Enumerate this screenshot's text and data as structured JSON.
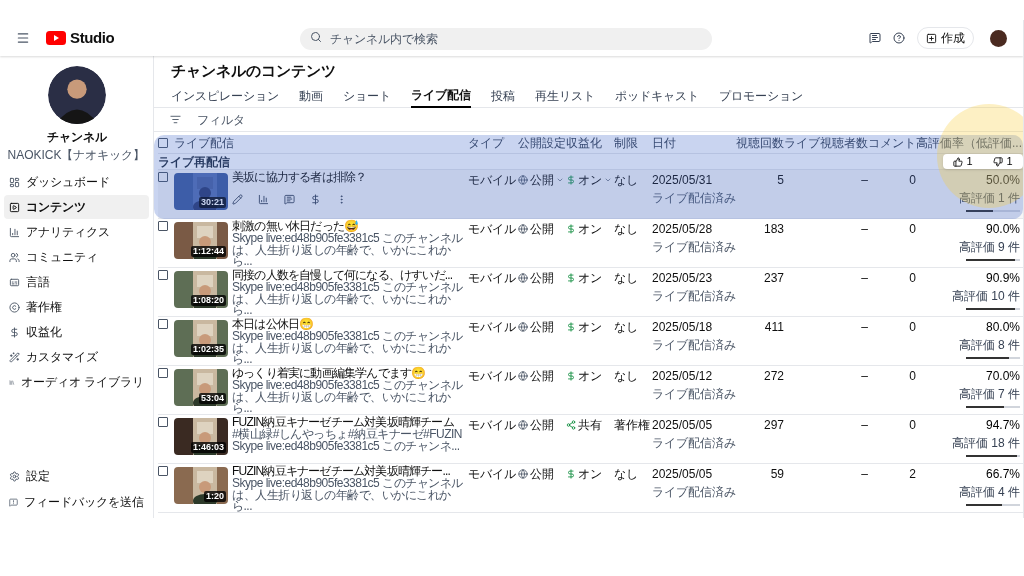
{
  "header": {
    "logo": "Studio",
    "search": {
      "placeholder": "チャンネル内で検索"
    },
    "create": "作成"
  },
  "sidebar": {
    "title": "チャンネル",
    "subtitle": "NAOKICK【ナオキック】",
    "items": [
      {
        "kind": "dashboard",
        "label": "ダッシュボード",
        "selected": false
      },
      {
        "kind": "content",
        "label": "コンテンツ",
        "selected": true
      },
      {
        "kind": "analytics",
        "label": "アナリティクス",
        "selected": false
      },
      {
        "kind": "community",
        "label": "コミュニティ",
        "selected": false
      },
      {
        "kind": "subtitles",
        "label": "言語",
        "selected": false
      },
      {
        "kind": "copyright",
        "label": "著作権",
        "selected": false
      },
      {
        "kind": "earn",
        "label": "収益化",
        "selected": false
      },
      {
        "kind": "customize",
        "label": "カスタマイズ",
        "selected": false
      },
      {
        "kind": "audio",
        "label": "オーディオ ライブラリ",
        "selected": false
      }
    ],
    "footer": [
      {
        "kind": "settings",
        "label": "設定"
      },
      {
        "kind": "feedback",
        "label": "フィードバックを送信"
      }
    ]
  },
  "page_title": "チャンネルのコンテンツ",
  "tabs": [
    {
      "label": "インスピレーション",
      "selected": false
    },
    {
      "label": "動画",
      "selected": false
    },
    {
      "label": "ショート",
      "selected": false
    },
    {
      "label": "ライブ配信",
      "selected": true
    },
    {
      "label": "投稿",
      "selected": false
    },
    {
      "label": "再生リスト",
      "selected": false
    },
    {
      "label": "ポッドキャスト",
      "selected": false
    },
    {
      "label": "プロモーション",
      "selected": false
    }
  ],
  "filter": {
    "placeholder": "フィルタ"
  },
  "table": {
    "select_all_checked": false,
    "columns": [
      "ライブ配信",
      "タイプ",
      "公開設定",
      "収益化",
      "制限",
      "日付",
      "視聴回数",
      "ライブ視聴者数",
      "コメント",
      "高評価率（低評価..."
    ],
    "group": "ライブ再配信",
    "rows": [
      {
        "checked": false,
        "title": "美坂に協力する者は排除？",
        "description": "",
        "duration": "30:21",
        "hovered": true,
        "type": "モバイル",
        "visibility": "公開",
        "monetization": {
          "kind": "dollar",
          "label": "オン"
        },
        "restriction": "なし",
        "date": "2025/05/31",
        "date_status": "ライブ配信済み",
        "views": "5",
        "live_viewers": "–",
        "comments": "0",
        "rating": "50.0%",
        "likes": "高評価 1 件",
        "level": 0.5,
        "tooltip": {
          "likes": "1",
          "dislikes": "1"
        }
      },
      {
        "checked": false,
        "title": "刺激の無い休日だった😅",
        "description": "Skype live:ed48b905fe3381c5 このチャンネルは、人生折り返しの年齢で、いかにこれから...",
        "duration": "1:12:44",
        "hovered": false,
        "type": "モバイル",
        "visibility": "公開",
        "monetization": {
          "kind": "dollar",
          "label": "オン"
        },
        "restriction": "なし",
        "date": "2025/05/28",
        "date_status": "ライブ配信済み",
        "views": "183",
        "live_viewers": "–",
        "comments": "0",
        "rating": "90.0%",
        "likes": "高評価 9 件",
        "level": 0.9
      },
      {
        "checked": false,
        "title": "同接の人数を自慢して何になる、けすいだ...",
        "description": "Skype live:ed48b905fe3381c5 このチャンネルは、人生折り返しの年齢で、いかにこれから...",
        "duration": "1:08:20",
        "hovered": false,
        "type": "モバイル",
        "visibility": "公開",
        "monetization": {
          "kind": "dollar",
          "label": "オン"
        },
        "restriction": "なし",
        "date": "2025/05/23",
        "date_status": "ライブ配信済み",
        "views": "237",
        "live_viewers": "–",
        "comments": "0",
        "rating": "90.9%",
        "likes": "高評価 10 件",
        "level": 0.909
      },
      {
        "checked": false,
        "title": "本日は公休日😁",
        "description": "Skype live:ed48b905fe3381c5 このチャンネルは、人生折り返しの年齢で、いかにこれから...",
        "duration": "1:02:35",
        "hovered": false,
        "type": "モバイル",
        "visibility": "公開",
        "monetization": {
          "kind": "dollar",
          "label": "オン"
        },
        "restriction": "なし",
        "date": "2025/05/18",
        "date_status": "ライブ配信済み",
        "views": "411",
        "live_viewers": "–",
        "comments": "0",
        "rating": "80.0%",
        "likes": "高評価 8 件",
        "level": 0.8
      },
      {
        "checked": false,
        "title": "ゆっくり着実に動画編集学んでます😁",
        "description": "Skype live:ed48b905fe3381c5 このチャンネルは、人生折り返しの年齢で、いかにこれから...",
        "duration": "53:04",
        "hovered": false,
        "type": "モバイル",
        "visibility": "公開",
        "monetization": {
          "kind": "dollar",
          "label": "オン"
        },
        "restriction": "なし",
        "date": "2025/05/12",
        "date_status": "ライブ配信済み",
        "views": "272",
        "live_viewers": "–",
        "comments": "0",
        "rating": "70.0%",
        "likes": "高評価 7 件",
        "level": 0.7
      },
      {
        "checked": false,
        "title": "FUZIN納豆キナーゼチーム対美坂晴輝チーム",
        "description": "#横山緑#しんやっちょ#納豆キナーゼ#FUZIN Skype live:ed48b905fe3381c5 このチャンネ...",
        "duration": "1:46:03",
        "hovered": false,
        "type": "モバイル",
        "visibility": "公開",
        "monetization": {
          "kind": "share",
          "label": "共有"
        },
        "restriction": "著作権",
        "date": "2025/05/05",
        "date_status": "ライブ配信済み",
        "views": "297",
        "live_viewers": "–",
        "comments": "0",
        "rating": "94.7%",
        "likes": "高評価 18 件",
        "level": 0.947
      },
      {
        "checked": false,
        "title": "FUZIN納豆キナーゼチーム対美坂晴輝チー...",
        "description": "Skype live:ed48b905fe3381c5 このチャンネルは、人生折り返しの年齢で、いかにこれから...",
        "duration": "1:20",
        "hovered": false,
        "type": "モバイル",
        "visibility": "公開",
        "monetization": {
          "kind": "dollar",
          "label": "オン"
        },
        "restriction": "なし",
        "date": "2025/05/05",
        "date_status": "ライブ配信済み",
        "views": "59",
        "live_viewers": "–",
        "comments": "2",
        "rating": "66.7%",
        "likes": "高評価 4 件",
        "level": 0.667
      }
    ]
  },
  "annotation": {
    "highlight": true,
    "spotlight": true
  }
}
